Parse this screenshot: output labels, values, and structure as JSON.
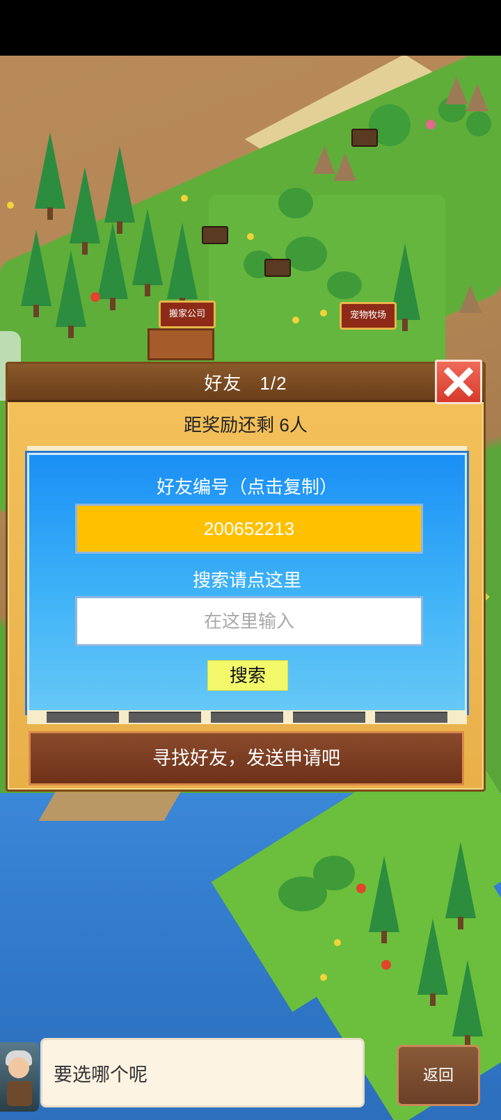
{
  "world": {
    "signs": [
      {
        "label": "搬家公司"
      },
      {
        "label": "宠物牧场"
      }
    ]
  },
  "dialog": {
    "title": "好友",
    "page": "1/2",
    "reward_text": "距奖励还剩 6人",
    "friend_id_label": "好友编号（点击复制）",
    "friend_id": "200652213",
    "search_label": "搜索请点这里",
    "search_placeholder": "在这里输入",
    "search_value": "",
    "search_button": "搜索",
    "find_friends": "寻找好友，发送申请吧"
  },
  "bottom": {
    "speech": "要选哪个呢",
    "back": "返回"
  },
  "colors": {
    "panel_blue": "#1a8ff5",
    "id_box": "#ffc000",
    "close_red": "#d63a2c",
    "search_btn": "#f2f86a"
  },
  "icons": [
    "close-icon",
    "arrow-left-icon",
    "arrow-right-icon"
  ]
}
